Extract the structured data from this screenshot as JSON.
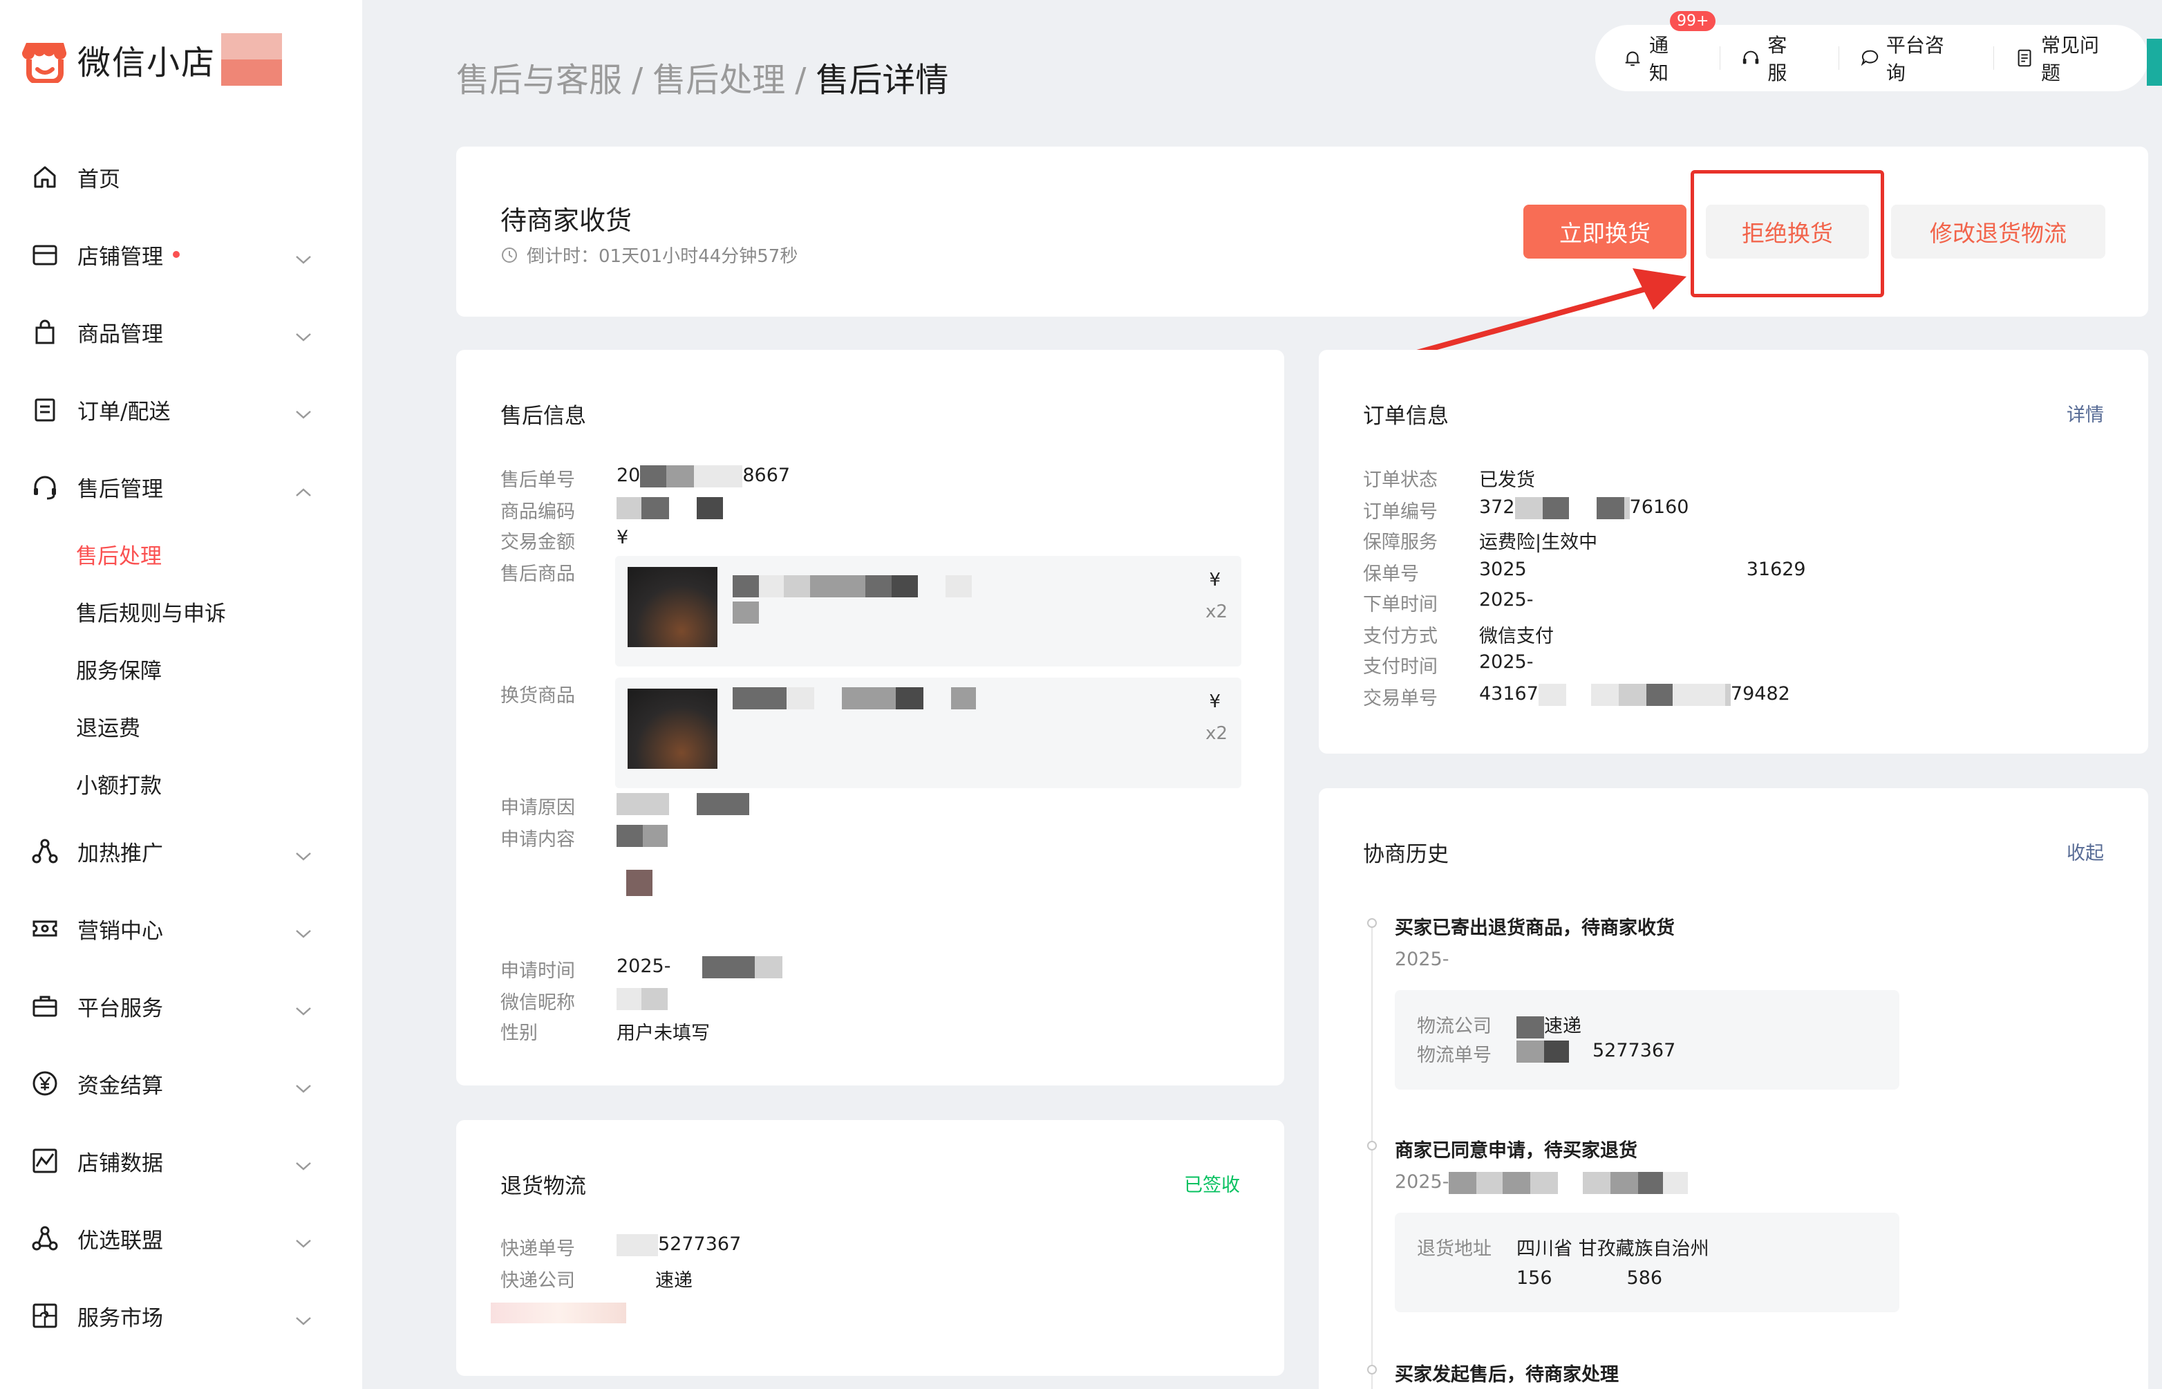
{
  "brand": {
    "name": "微信小店"
  },
  "sidebar": {
    "items": [
      {
        "label": "首页",
        "icon": "home-icon"
      },
      {
        "label": "店铺管理",
        "icon": "store-icon",
        "dot": true
      },
      {
        "label": "商品管理",
        "icon": "bag-icon"
      },
      {
        "label": "订单/配送",
        "icon": "clipboard-icon"
      },
      {
        "label": "售后管理",
        "icon": "headset-icon",
        "expanded": true
      }
    ],
    "subitems": [
      {
        "label": "售后处理",
        "active": true
      },
      {
        "label": "售后规则与申诉"
      },
      {
        "label": "服务保障"
      },
      {
        "label": "退运费"
      },
      {
        "label": "小额打款"
      }
    ],
    "items_after": [
      {
        "label": "加热推广",
        "icon": "share-nodes-icon"
      },
      {
        "label": "营销中心",
        "icon": "ticket-icon"
      },
      {
        "label": "平台服务",
        "icon": "briefcase-icon"
      },
      {
        "label": "资金结算",
        "icon": "yuan-icon"
      },
      {
        "label": "店铺数据",
        "icon": "chart-icon"
      },
      {
        "label": "优选联盟",
        "icon": "network-icon"
      },
      {
        "label": "服务市场",
        "icon": "puzzle-icon"
      }
    ]
  },
  "breadcrumb": {
    "level1": "售后与客服",
    "level2": "售后处理",
    "current": "售后详情",
    "separator": "/"
  },
  "topbar": {
    "notify": "通知",
    "notify_badge": "99+",
    "service": "客服",
    "consult": "平台咨询",
    "faq": "常见问题"
  },
  "status": {
    "title": "待商家收货",
    "countdown_label": "倒计时：",
    "countdown": "01天01小时44分钟57秒",
    "btn_exchange": "立即换货",
    "btn_reject": "拒绝换货",
    "btn_modify": "修改退货物流"
  },
  "aftersale": {
    "title": "售后信息",
    "order_no_label": "售后单号",
    "order_no_prefix": "20",
    "order_no_suffix": "8667",
    "sku_label": "商品编码",
    "amount_label": "交易金额",
    "amount": "¥",
    "goods_label": "售后商品",
    "goods_price": "¥",
    "goods_qty": "x2",
    "exchange_label": "换货商品",
    "exchange_price": "¥",
    "exchange_qty": "x2",
    "reason_label": "申请原因",
    "content_label": "申请内容",
    "time_label": "申请时间",
    "time": "2025-",
    "nick_label": "微信昵称",
    "gender_label": "性别",
    "gender": "用户未填写"
  },
  "order": {
    "title": "订单信息",
    "link": "详情",
    "status_label": "订单状态",
    "status": "已发货",
    "no_label": "订单编号",
    "no_prefix": "372",
    "no_suffix": "76160",
    "guarantee_label": "保障服务",
    "guarantee": "运费险|生效中",
    "policy_label": "保单号",
    "policy_prefix": "3025",
    "policy_suffix": "31629",
    "order_time_label": "下单时间",
    "order_time": "2025-",
    "pay_label": "支付方式",
    "pay": "微信支付",
    "pay_time_label": "支付时间",
    "pay_time": "2025-",
    "trade_label": "交易单号",
    "trade_prefix": "43167",
    "trade_suffix": "79482"
  },
  "logistics": {
    "title": "退货物流",
    "status": "已签收",
    "tracking_label": "快递单号",
    "tracking": "5277367",
    "company_label": "快递公司",
    "company": "速递"
  },
  "history": {
    "title": "协商历史",
    "link": "收起",
    "events": [
      {
        "title": "买家已寄出退货商品，待商家收货",
        "date": "2025-",
        "rows": [
          {
            "k": "物流公司",
            "v": "速递"
          },
          {
            "k": "物流单号",
            "v": "5277367"
          }
        ]
      },
      {
        "title": "商家已同意申请，待买家退货",
        "date": "2025-",
        "rows": [
          {
            "k": "退货地址",
            "v": "四川省 甘孜藏族自治州"
          },
          {
            "k": "",
            "v": "156　　　　586"
          }
        ]
      },
      {
        "title": "买家发起售后，待商家处理"
      }
    ]
  },
  "colors": {
    "accent": "#fa5151",
    "primary_button": "#f86d55",
    "link": "#576b95",
    "success": "#07c160",
    "highlight": "#e8322a"
  }
}
